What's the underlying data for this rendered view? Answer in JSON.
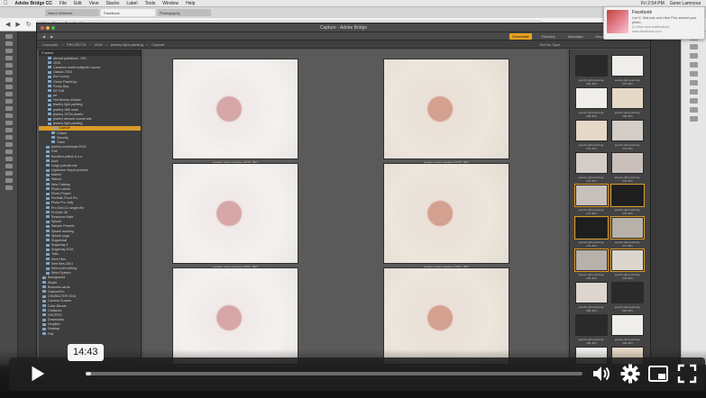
{
  "menubar": {
    "app": "Adobe Bridge CC",
    "items": [
      "File",
      "Edit",
      "View",
      "Stacks",
      "Label",
      "Tools",
      "Window",
      "Help"
    ],
    "time": "Fri 2:54 PM",
    "user": "Gene Lamnova"
  },
  "browser": {
    "tabs": [
      "Neuro Wireless",
      "Facebook",
      "Photography"
    ],
    "url": "https://www.facebook.com"
  },
  "bridge": {
    "title": "Capture - Adobe Bridge",
    "workspaces": [
      "Essentials",
      "Filmstrip",
      "Metadata",
      "Keywords"
    ],
    "active_workspace": "Essentials",
    "path": [
      "Computer",
      "PROJECTS",
      "2016",
      "jewelry light painting",
      "Capture"
    ],
    "panel_title": "Folders",
    "sort_label": "Sort by Type",
    "folders": [
      "Almost published - 000",
      "2015",
      "Cameron marlin subjects' course",
      "Classic 2016",
      "Eco Luxury",
      "Green FlashCap",
      "Fundy Bay",
      "NY Coll",
      "art",
      "Hot Berney recipes",
      "jewelry light painting",
      "jewelry 18th sean",
      "jewelry 1970s jewels",
      "jewelry artwork course ads",
      "jewelry light painting",
      "Capture",
      "Output",
      "Security",
      "Trash",
      "jewelry workshops 2016",
      "Grill",
      "Kirnetics yellow & e.s",
      "Aunt",
      "Large portrait mat",
      "Lightroom Import preview",
      "Marble",
      "Walnut",
      "New Catalog",
      "Photo Labels",
      "Photo Project",
      "Portfolio Proof Pro",
      "Photo Pro Jelly",
      "Pro Grid 21 ranges file",
      "ProCalc 36",
      "Resource Mate",
      "Splash",
      "Sample Presets",
      "Splash tracking",
      "Splash yoga",
      "Sugarbowl",
      "Sugarbay 4",
      "Sugarbay 2016",
      "Tabs",
      "Sent Files",
      "Sent files 2014",
      "Word print setting",
      "Word System",
      "Background",
      "Studio",
      "Business cards",
      "CapturePro",
      "CHARACTER 2014",
      "Camera Crowns",
      "Color Blends",
      "Craftwork",
      "DHCPRO",
      "Downloads",
      "DropBox",
      "Desktop",
      "Fiat"
    ],
    "selected_folder_index": 15,
    "photo_labels": [
      "jewelry-light-painting-0578.JPG",
      "jewelry-light-painting-0579.JPG",
      "jewelry-light-painting-0580.JPG",
      "jewelry-light-painting-0581.JPG",
      "jewelry-light-painting-0582.JPG",
      "jewelry-light-painting-0583.JPG"
    ],
    "thumb_labels": [
      "jewelry-light-painting-266.JPG",
      "jewelry-light-painting-267.JPG",
      "jewelry-light-painting-268.JPG",
      "jewelry-light-painting-269.JPG",
      "jewelry-light-painting-270.JPG",
      "jewelry-light-painting-271.JPG",
      "jewelry-light-painting-272.JPG",
      "jewelry-light-painting-273.JPG",
      "jewelry-light-painting-274.JPG",
      "jewelry-light-painting-275.JPG",
      "jewelry-light-painting-276.JPG",
      "jewelry-light-painting-277.JPG",
      "jewelry-light-painting-278.JPG",
      "jewelry-light-painting-279.JPG",
      "jewelry-light-painting-280.JPG",
      "jewelry-light-painting-281.JPG",
      "jewelry-light-painting-282.JPG",
      "jewelry-light-painting-283.JPG"
    ]
  },
  "notification": {
    "title": "Facebook",
    "body": "Lori K. Marcolo and Uber Pixx shared your photo.",
    "link": "(1 other new notification)",
    "source": "www.facebook.com"
  },
  "player": {
    "time": "14:43",
    "progress_fraction": 0.01,
    "play_icon": "play-icon",
    "volume_icon": "volume-icon",
    "settings_icon": "gear-icon",
    "pip_icon": "pip-icon",
    "fullscreen_icon": "fullscreen-icon"
  },
  "colors": {
    "accent": "#d99a26",
    "bridge_bg": "#535353"
  }
}
